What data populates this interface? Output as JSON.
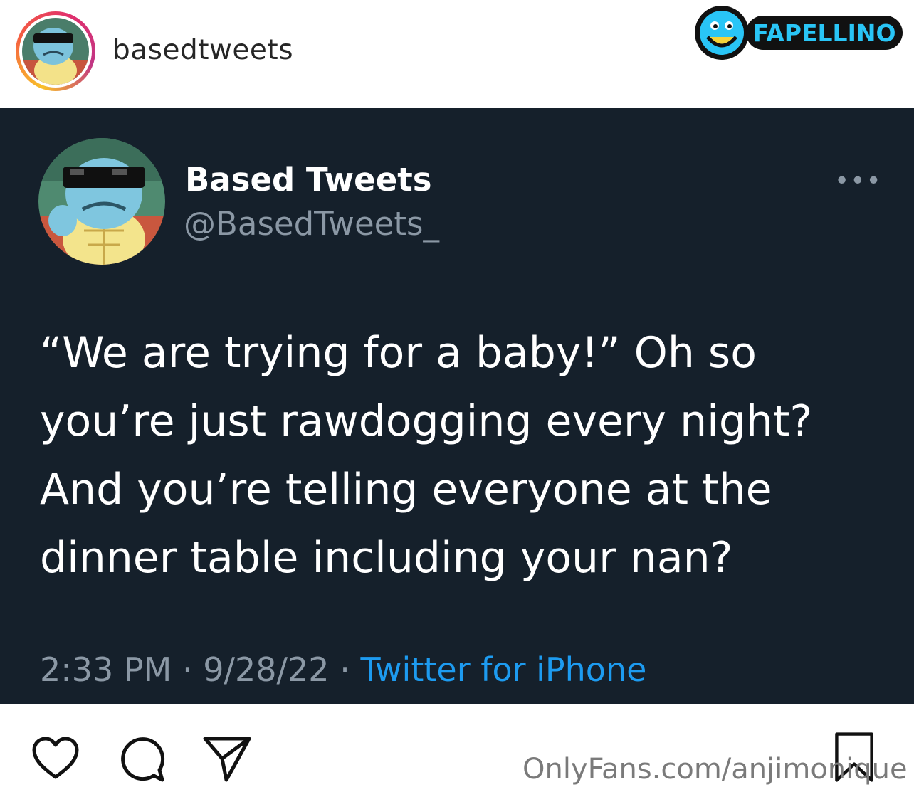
{
  "post": {
    "username": "basedtweets",
    "avatar_icon": "squirtle-sunglasses-avatar"
  },
  "brand": {
    "logo_text": "FAPELLINO",
    "accent_color": "#29c5f6"
  },
  "tweet": {
    "display_name": "Based Tweets",
    "handle": "@BasedTweets_",
    "more_icon": "more-dots-icon",
    "text": "“We are trying for a baby!” Oh so\nyou’re just rawdogging every night?\nAnd you’re telling everyone at the\ndinner table including your nan?",
    "time": "2:33 PM",
    "date": "9/28/22",
    "separator": " · ",
    "source": "Twitter for iPhone",
    "background_color": "#15202b",
    "link_color": "#1d9bf0"
  },
  "actions": {
    "like_icon": "heart-icon",
    "comment_icon": "comment-icon",
    "share_icon": "send-icon",
    "save_icon": "bookmark-icon"
  },
  "watermark": {
    "text": "OnlyFans.com/anjimonique"
  }
}
